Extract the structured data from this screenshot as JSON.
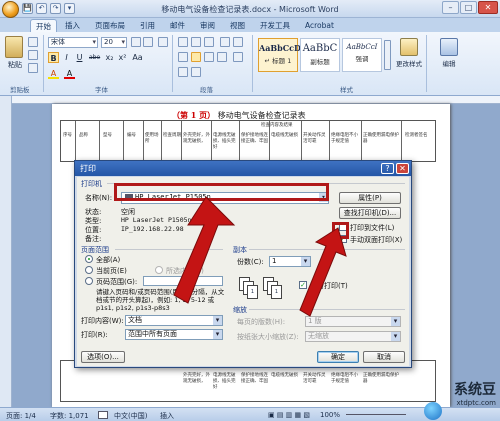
{
  "window": {
    "title": "移动电气设备检查记录表.docx - Microsoft Word",
    "minimize": "–",
    "maximize": "□",
    "close": "✕"
  },
  "qat": [
    "💾",
    "↶",
    "↷",
    "▾"
  ],
  "ribbon": {
    "tabs": [
      "开始",
      "插入",
      "页面布局",
      "引用",
      "邮件",
      "审阅",
      "视图",
      "开发工具",
      "Acrobat"
    ],
    "clipboard": {
      "paste": "粘贴",
      "group": "剪贴板"
    },
    "font": {
      "name": "宋体",
      "size": "20",
      "group": "字体",
      "buttons": [
        "B",
        "I",
        "U",
        "abe",
        "x₂",
        "x²",
        "Aa",
        "A",
        "A"
      ]
    },
    "paragraph": {
      "group": "段落"
    },
    "styles": {
      "items": [
        {
          "sample": "AaBbCcD",
          "name": "↵ 标题 1"
        },
        {
          "sample": "AaBbC",
          "name": "副标题"
        },
        {
          "sample": "AaBbCcI",
          "name": "强调"
        }
      ],
      "change": "更改样式",
      "group": "样式"
    },
    "editing": {
      "label": "编辑"
    }
  },
  "document": {
    "heading_prefix": "（第 1 页）",
    "heading": "移动电气设备检查记录表",
    "row_heading": "检查内容及结果",
    "cells": [
      "序号",
      "品称",
      "型号",
      "编号",
      "使用场所",
      "检查周期",
      "外壳完好，外观无破损，",
      "电源线无破损、插头完好",
      "保护接地线连接正确、牢固",
      "电缆线无破损",
      "开关动作灵活可靠",
      "绝缘电阻不小于规定值",
      "正确使用漏电保护器",
      "检测者签名"
    ]
  },
  "statusbar": {
    "page": "页面: 1/4",
    "words": "字数: 1,071",
    "lang": "中文(中国)",
    "mode": "插入",
    "zoom": "100%"
  },
  "print_dialog": {
    "title": "打印",
    "help": "?",
    "close": "✕",
    "printer_section": "打印机",
    "name_label": "名称(N):",
    "printer_name": "HP LaserJet P1505n",
    "status_label": "状态:",
    "status_value": "空闲",
    "type_label": "类型:",
    "type_value": "HP LaserJet P1505n",
    "where_label": "位置:",
    "where_value": "IP_192.168.22.98",
    "comment_label": "备注:",
    "comment_value": "",
    "properties_btn": "属性(P)",
    "find_printer_btn": "查找打印机(D)...",
    "print_to_file": "打印到文件(L)",
    "manual_duplex": "手动双面打印(X)",
    "range_section": "页面范围",
    "range_all": "全部(A)",
    "range_current": "当前页(E)",
    "range_selection": "所选内容(S)",
    "range_pages": "页码范围(G):",
    "range_hint": "请键入页码和/或页码范围(用逗号分隔，从文档或节的开头算起)，例如: 1, 3, 5-12 或 p1s1, p1s2, p1s3-p8s3",
    "copies_section": "副本",
    "copies_label": "份数(C):",
    "copies_value": "1",
    "collate": "逐份打印(T)",
    "print_what_label": "打印内容(W):",
    "print_what_value": "文档",
    "print_label": "打印(R):",
    "print_value": "范围中所有页面",
    "zoom_section": "缩放",
    "pages_per_sheet_label": "每页的版数(H):",
    "pages_per_sheet_value": "1 版",
    "scale_label": "按纸张大小缩放(Z):",
    "scale_value": "无缩放",
    "options_btn": "选项(O)...",
    "ok_btn": "确定",
    "cancel_btn": "取消"
  },
  "watermark": {
    "brand": "系统豆",
    "url": "xtdptc.com"
  },
  "colors": {
    "highlight": "#b01818",
    "title_blue": "#2456a6",
    "check_green": "#1c9c24"
  }
}
